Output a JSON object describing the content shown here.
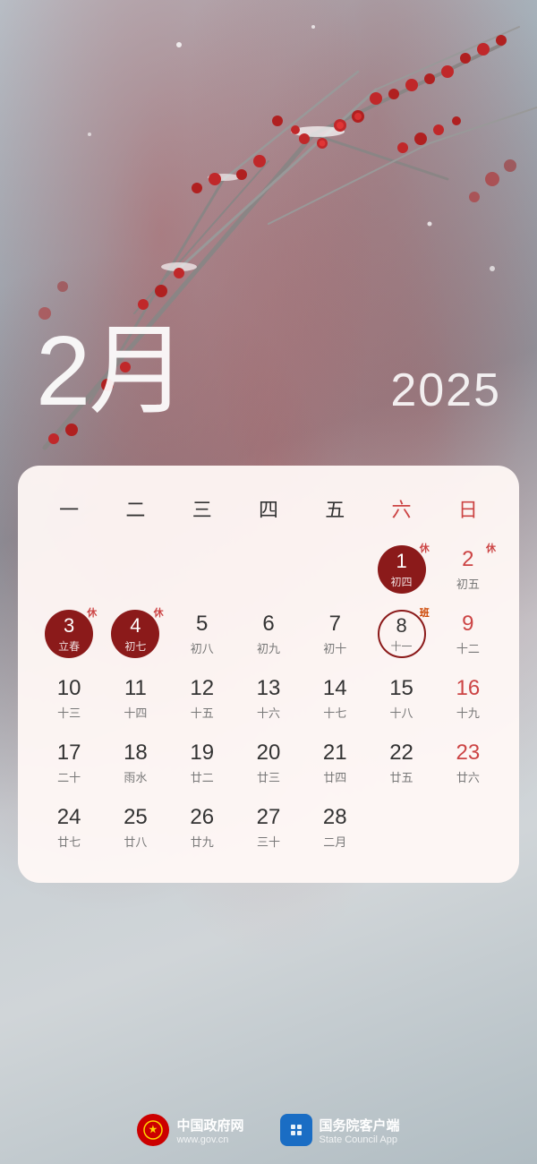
{
  "title": {
    "month": "2月",
    "year": "2025",
    "month_num": "2"
  },
  "calendar": {
    "dow_headers": [
      "一",
      "二",
      "三",
      "四",
      "五",
      "六",
      "日"
    ],
    "weeks": [
      [
        {
          "day": "",
          "lunar": "",
          "type": "empty"
        },
        {
          "day": "",
          "lunar": "",
          "type": "empty"
        },
        {
          "day": "",
          "lunar": "",
          "type": "empty"
        },
        {
          "day": "",
          "lunar": "",
          "type": "empty"
        },
        {
          "day": "",
          "lunar": "",
          "type": "empty"
        },
        {
          "day": "1",
          "lunar": "初四",
          "type": "red",
          "badge": "休"
        },
        {
          "day": "2",
          "lunar": "初五",
          "type": "normal-sun",
          "badge": "休"
        }
      ],
      [
        {
          "day": "3",
          "lunar": "立春",
          "type": "red",
          "badge": "休"
        },
        {
          "day": "4",
          "lunar": "初七",
          "type": "red",
          "badge": "休"
        },
        {
          "day": "5",
          "lunar": "初八",
          "type": "normal"
        },
        {
          "day": "6",
          "lunar": "初九",
          "type": "normal"
        },
        {
          "day": "7",
          "lunar": "初十",
          "type": "normal"
        },
        {
          "day": "8",
          "lunar": "十一",
          "type": "outline",
          "badge": "班"
        },
        {
          "day": "9",
          "lunar": "十二",
          "type": "normal-sun"
        }
      ],
      [
        {
          "day": "10",
          "lunar": "十三",
          "type": "normal"
        },
        {
          "day": "11",
          "lunar": "十四",
          "type": "normal"
        },
        {
          "day": "12",
          "lunar": "十五",
          "type": "normal"
        },
        {
          "day": "13",
          "lunar": "十六",
          "type": "normal"
        },
        {
          "day": "14",
          "lunar": "十七",
          "type": "normal"
        },
        {
          "day": "15",
          "lunar": "十八",
          "type": "normal"
        },
        {
          "day": "16",
          "lunar": "十九",
          "type": "normal-sun"
        }
      ],
      [
        {
          "day": "17",
          "lunar": "二十",
          "type": "normal"
        },
        {
          "day": "18",
          "lunar": "雨水",
          "type": "normal"
        },
        {
          "day": "19",
          "lunar": "廿二",
          "type": "normal"
        },
        {
          "day": "20",
          "lunar": "廿三",
          "type": "normal"
        },
        {
          "day": "21",
          "lunar": "廿四",
          "type": "normal"
        },
        {
          "day": "22",
          "lunar": "廿五",
          "type": "normal"
        },
        {
          "day": "23",
          "lunar": "廿六",
          "type": "normal-sun"
        }
      ],
      [
        {
          "day": "24",
          "lunar": "廿七",
          "type": "normal"
        },
        {
          "day": "25",
          "lunar": "廿八",
          "type": "normal"
        },
        {
          "day": "26",
          "lunar": "廿九",
          "type": "normal"
        },
        {
          "day": "27",
          "lunar": "三十",
          "type": "normal"
        },
        {
          "day": "28",
          "lunar": "二月",
          "type": "normal"
        },
        {
          "day": "",
          "lunar": "",
          "type": "empty"
        },
        {
          "day": "",
          "lunar": "",
          "type": "empty"
        }
      ]
    ]
  },
  "footer": {
    "brand1": {
      "name": "中国政府网",
      "sub": "www.gov.cn",
      "icon": "🏛"
    },
    "brand2": {
      "name": "国务院客户端",
      "sub": "State Council App",
      "icon": "📱"
    }
  }
}
